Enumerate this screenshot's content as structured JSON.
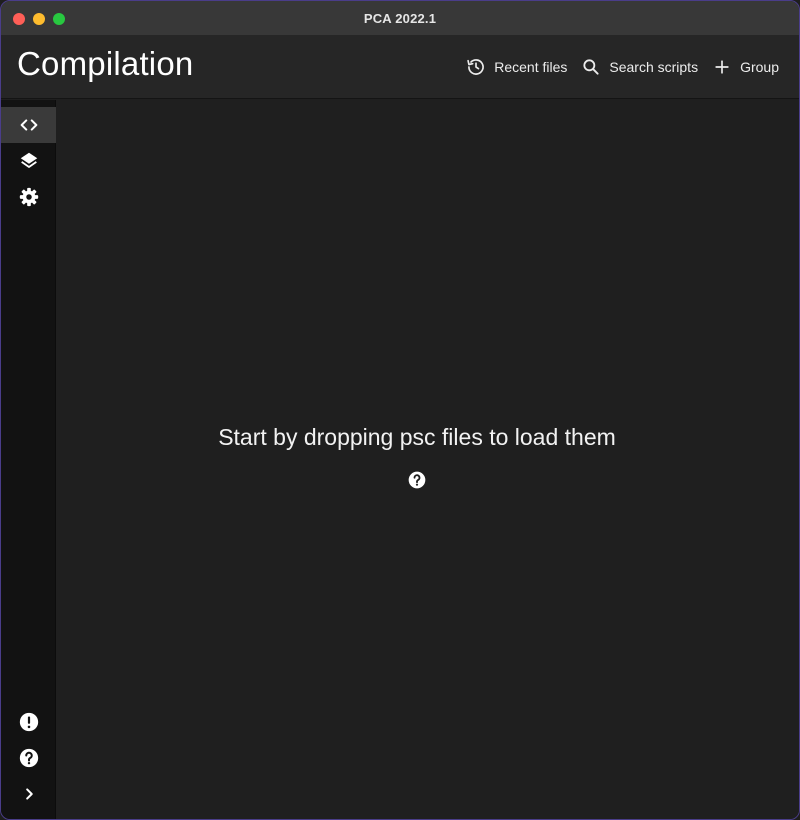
{
  "window": {
    "title": "PCA 2022.1"
  },
  "header": {
    "title": "Compilation",
    "actions": [
      {
        "label": "Recent files",
        "icon": "history-icon"
      },
      {
        "label": "Search scripts",
        "icon": "search-icon"
      },
      {
        "label": "Group",
        "icon": "plus-icon"
      }
    ]
  },
  "sidebar": {
    "top_items": [
      {
        "icon": "code-icon",
        "active": true
      },
      {
        "icon": "layers-icon",
        "active": false
      },
      {
        "icon": "gear-icon",
        "active": false
      }
    ],
    "bottom_items": [
      {
        "icon": "alert-icon"
      },
      {
        "icon": "help-icon"
      },
      {
        "icon": "chevron-right-icon"
      }
    ]
  },
  "main": {
    "empty_message": "Start by dropping psc files to load them",
    "help_icon": "help-icon"
  },
  "colors": {
    "background": "#1f1f1f",
    "header": "#262626",
    "sidebar": "#121212",
    "active_item": "#3a3a3a"
  }
}
